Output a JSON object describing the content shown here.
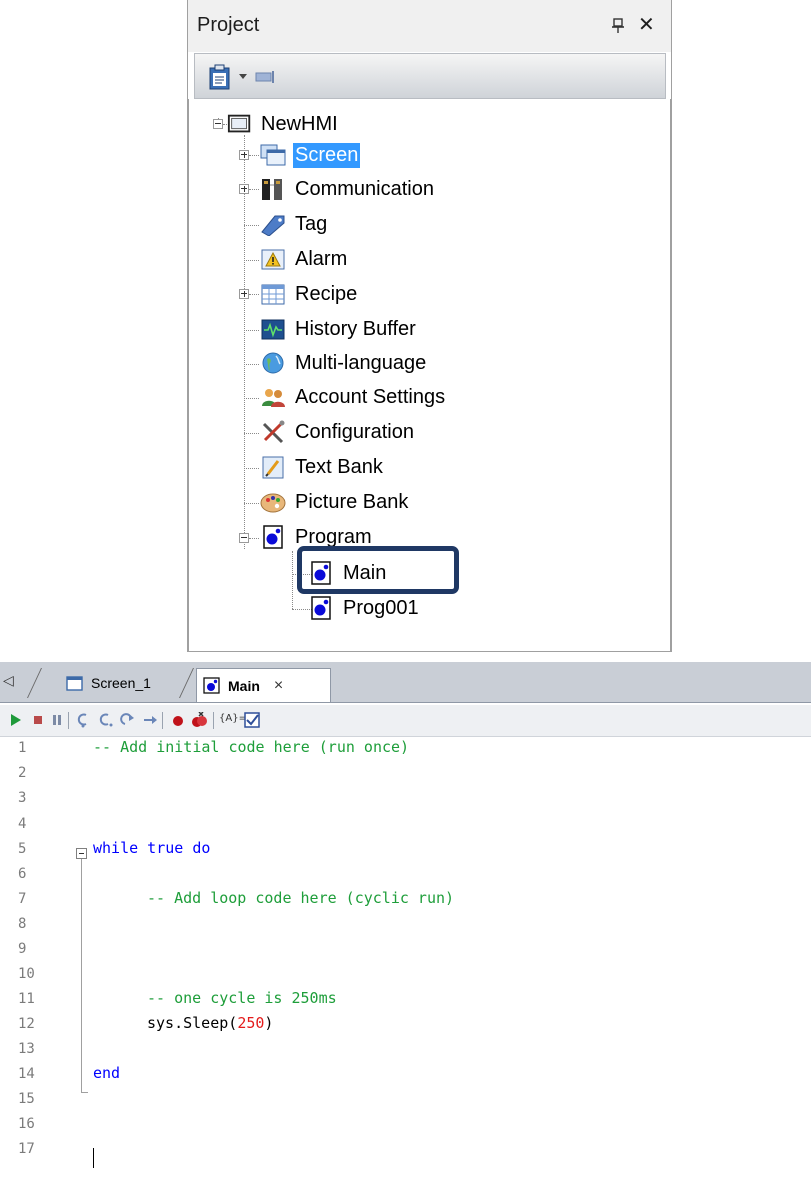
{
  "panel": {
    "title": "Project",
    "pin_icon": "pin-icon",
    "close_symbol": "✕"
  },
  "tree": {
    "root": "NewHMI",
    "items": [
      {
        "label": "Screen",
        "icon": "screen-icon",
        "expander": "plus",
        "selected": true
      },
      {
        "label": "Communication",
        "icon": "communication-icon",
        "expander": "plus"
      },
      {
        "label": "Tag",
        "icon": "tag-icon"
      },
      {
        "label": "Alarm",
        "icon": "alarm-icon"
      },
      {
        "label": "Recipe",
        "icon": "recipe-icon",
        "expander": "plus"
      },
      {
        "label": "History Buffer",
        "icon": "history-buffer-icon"
      },
      {
        "label": "Multi-language",
        "icon": "globe-icon"
      },
      {
        "label": "Account Settings",
        "icon": "users-icon"
      },
      {
        "label": "Configuration",
        "icon": "tools-icon"
      },
      {
        "label": "Text Bank",
        "icon": "text-bank-icon"
      },
      {
        "label": "Picture Bank",
        "icon": "palette-icon"
      },
      {
        "label": "Program",
        "icon": "program-icon",
        "expander": "minus"
      }
    ],
    "program_children": [
      {
        "label": "Main",
        "icon": "program-icon",
        "highlighted": true
      },
      {
        "label": "Prog001",
        "icon": "program-icon"
      }
    ]
  },
  "editor": {
    "tabs": [
      {
        "label": "Screen_1",
        "icon": "screen-icon",
        "active": false
      },
      {
        "label": "Main",
        "icon": "program-icon",
        "active": true,
        "close": "×"
      }
    ],
    "toolbar": [
      "run-icon",
      "stop-icon",
      "pause-icon",
      "step-into-icon",
      "step-over-icon",
      "step-out-icon",
      "run-to-cursor-icon",
      "breakpoint-icon",
      "clear-breakpoints-icon",
      "variable-icon",
      "check-syntax-icon"
    ],
    "variable_label": "{A}=",
    "lines": [
      {
        "n": "1",
        "text": "-- Add initial code here (run once)",
        "kind": "comment",
        "indent": ""
      },
      {
        "n": "2",
        "text": ""
      },
      {
        "n": "3",
        "text": ""
      },
      {
        "n": "4",
        "text": ""
      },
      {
        "n": "5",
        "text": "while true do",
        "kind": "keyword",
        "indent": ""
      },
      {
        "n": "6",
        "text": ""
      },
      {
        "n": "7",
        "text": "-- Add loop code here (cyclic run)",
        "kind": "comment",
        "indent": "    "
      },
      {
        "n": "8",
        "text": ""
      },
      {
        "n": "9",
        "text": ""
      },
      {
        "n": "10",
        "text": ""
      },
      {
        "n": "11",
        "text": "-- one cycle is 250ms",
        "kind": "comment",
        "indent": "    "
      },
      {
        "n": "12",
        "text": "sys.Sleep(",
        "arg": "250",
        "close": ")",
        "kind": "call",
        "indent": "    "
      },
      {
        "n": "13",
        "text": ""
      },
      {
        "n": "14",
        "text": "end",
        "kind": "keyword",
        "indent": ""
      },
      {
        "n": "15",
        "text": ""
      },
      {
        "n": "16",
        "text": ""
      },
      {
        "n": "17",
        "text": ""
      }
    ]
  }
}
